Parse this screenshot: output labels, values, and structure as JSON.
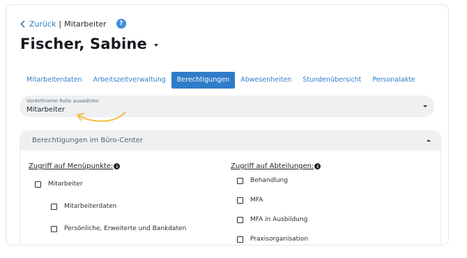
{
  "breadcrumb": {
    "back_label": "Zurück",
    "separator": "|",
    "current": "Mitarbeiter",
    "help": "?"
  },
  "employee": {
    "name": "Fischer, Sabine"
  },
  "tabs": [
    {
      "label": "Mitarbeiterdaten",
      "active": false
    },
    {
      "label": "Arbeitszeitverwaltung",
      "active": false
    },
    {
      "label": "Berechtigungen",
      "active": true
    },
    {
      "label": "Abwesenheiten",
      "active": false
    },
    {
      "label": "Stundenübersicht",
      "active": false
    },
    {
      "label": "Personalakte",
      "active": false
    }
  ],
  "role_select": {
    "label": "Vordefinierte Rolle auswählen",
    "value": "Mitarbeiter"
  },
  "section": {
    "title": "Berechtigungen im Büro-Center",
    "menu_heading": "Zugriff auf Menüpunkte:",
    "dept_heading": "Zugriff auf Abteilungen:",
    "menu_items": [
      {
        "label": "Mitarbeiter",
        "checked": false
      },
      {
        "label": "Mitarbeiterdaten",
        "checked": false
      },
      {
        "label": "Persönliche, Erweiterte und Bankdaten",
        "checked": false
      }
    ],
    "dept_items": [
      {
        "label": "Behandlung",
        "checked": false
      },
      {
        "label": "MFA",
        "checked": false
      },
      {
        "label": "MFA in Ausbildung",
        "checked": false
      },
      {
        "label": "Praxisorganisation",
        "checked": false
      }
    ]
  },
  "colors": {
    "accent": "#2f7cc9",
    "help_icon": "#3f8fdc",
    "annotation_arrow": "#f2c14e",
    "panel_bg": "#eef0f2"
  },
  "icons": {
    "back": "chevron-left-icon",
    "help": "question-icon",
    "info": "info-icon",
    "expand": "caret-down-icon",
    "collapse": "caret-up-icon"
  }
}
